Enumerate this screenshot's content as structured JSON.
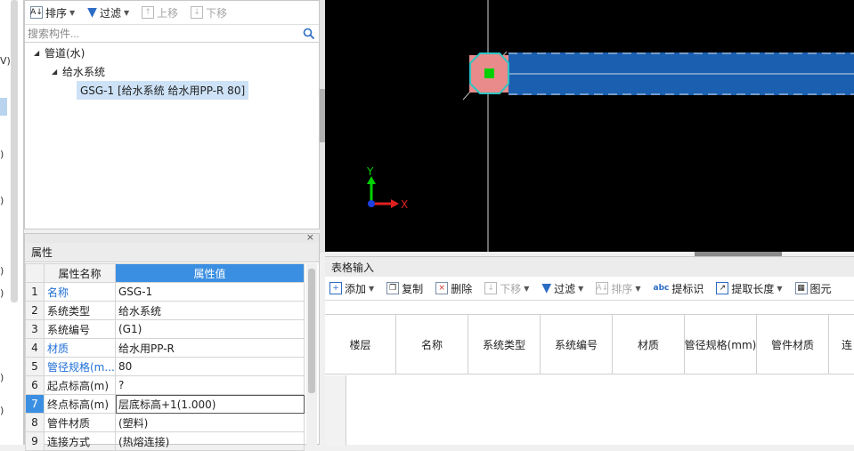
{
  "left_strip": {
    "fragments": [
      "V)",
      ")",
      ")",
      ")",
      ")",
      ")",
      ")"
    ]
  },
  "component_panel": {
    "toolbar": {
      "sort": "排序",
      "filter": "过滤",
      "move_up": "上移",
      "move_down": "下移"
    },
    "search": {
      "placeholder": "搜索构件..."
    },
    "tree": {
      "root": "管道(水)",
      "child": "给水系统",
      "leaf": "GSG-1 [给水系统 给水用PP-R 80]"
    }
  },
  "canvas": {
    "axis_y": "Y",
    "axis_x": "X"
  },
  "properties": {
    "title": "属性",
    "close": "×",
    "header": {
      "name": "属性名称",
      "value": "属性值"
    },
    "rows": [
      {
        "idx": "1",
        "name": "名称",
        "value": "GSG-1",
        "blue": true
      },
      {
        "idx": "2",
        "name": "系统类型",
        "value": "给水系统",
        "blue": false
      },
      {
        "idx": "3",
        "name": "系统编号",
        "value": "(G1)",
        "blue": false
      },
      {
        "idx": "4",
        "name": "材质",
        "value": "给水用PP-R",
        "blue": true
      },
      {
        "idx": "5",
        "name": "管径规格(m...",
        "value": "80",
        "blue": true
      },
      {
        "idx": "6",
        "name": "起点标高(m)",
        "value": "?",
        "blue": false
      },
      {
        "idx": "7",
        "name": "终点标高(m)",
        "value": "层底标高+1(1.000)",
        "blue": false
      },
      {
        "idx": "8",
        "name": "管件材质",
        "value": "(塑料)",
        "blue": false
      },
      {
        "idx": "9",
        "name": "连接方式",
        "value": "(热熔连接)",
        "blue": false
      }
    ]
  },
  "table_input": {
    "title": "表格输入",
    "toolbar": {
      "add": "添加",
      "copy": "复制",
      "delete": "删除",
      "move_down": "下移",
      "filter": "过滤",
      "sort": "排序",
      "extract_label": "提标识",
      "extract_length": "提取长度",
      "drawing": "图元"
    },
    "columns": [
      "楼层",
      "名称",
      "系统类型",
      "系统编号",
      "材质",
      "管径规格(mm)",
      "管件材质",
      "连"
    ]
  },
  "colors": {
    "accent": "#3b8fe2",
    "pipe": "#1a5fb0",
    "fitting": "#e98b8b",
    "fitting_outline": "#2ec4c4",
    "node": "#00d000"
  }
}
